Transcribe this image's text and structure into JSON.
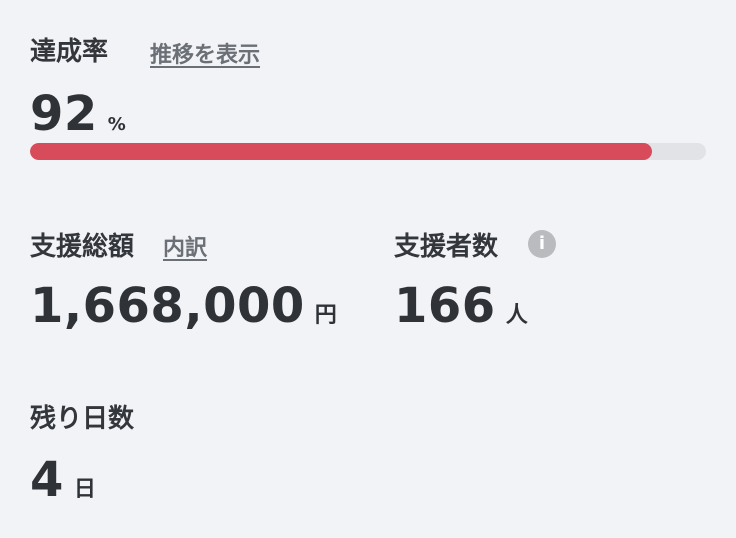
{
  "achievement": {
    "label": "達成率",
    "link": "推移を表示",
    "value": "92",
    "unit": "%",
    "progress": 0.92,
    "bar_color": "#d84b5a"
  },
  "total_support": {
    "label": "支援総額",
    "link": "内訳",
    "value": "1,668,000",
    "unit": "円"
  },
  "supporters": {
    "label": "支援者数",
    "info_icon": "i",
    "value": "166",
    "unit": "人"
  },
  "days_left": {
    "label": "残り日数",
    "value": "4",
    "unit": "日"
  }
}
